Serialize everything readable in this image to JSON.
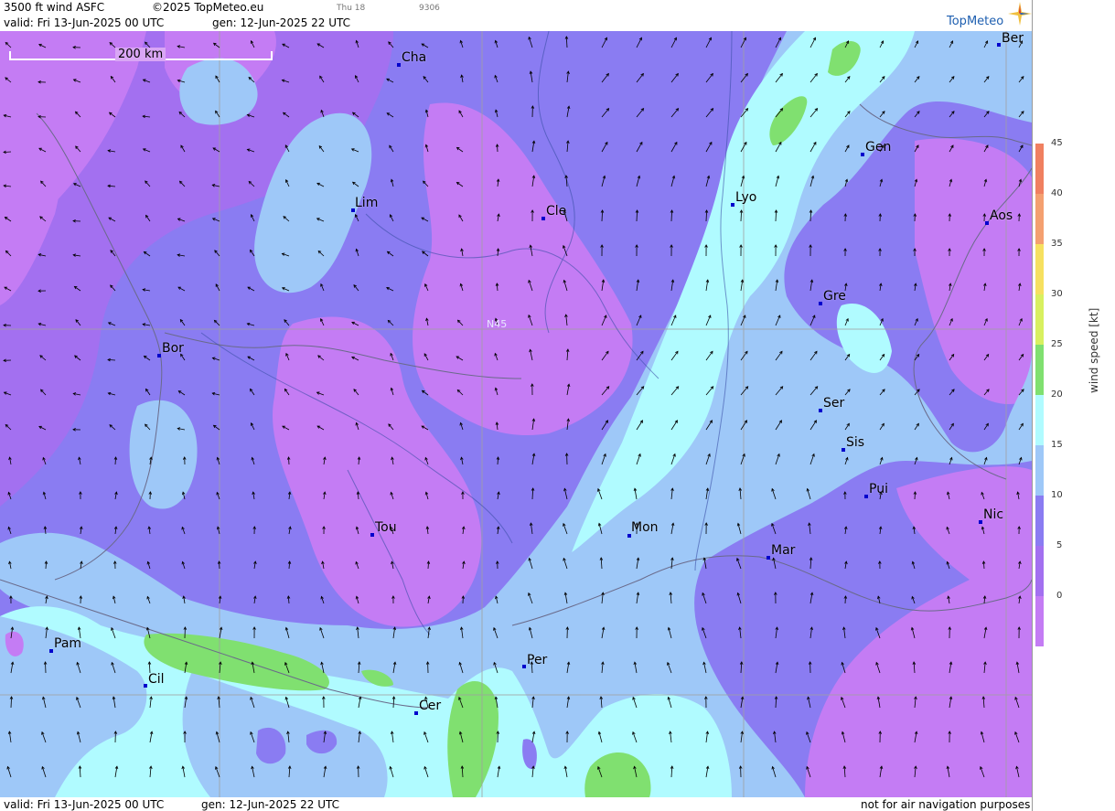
{
  "header": {
    "title": "3500 ft wind ASFC",
    "copyright": "©2025 TopMeteo.eu",
    "day_label": "Thu 18",
    "code": "9306",
    "valid": "valid:  Fri  13-Jun-2025  00 UTC",
    "gen": "gen: 12-Jun-2025 22 UTC",
    "logo": "TopMeteo"
  },
  "footer": {
    "valid": "valid:  Fri  13-Jun-2025  00 UTC",
    "gen": "gen: 12-Jun-2025 22 UTC",
    "disclaimer": "not for air navigation purposes"
  },
  "scale": {
    "label": "200 km"
  },
  "grid": {
    "lat_label": "N45"
  },
  "cities": [
    {
      "name": "Cha"
    },
    {
      "name": "Ber"
    },
    {
      "name": "Lim"
    },
    {
      "name": "Cle"
    },
    {
      "name": "Lyo"
    },
    {
      "name": "Gen"
    },
    {
      "name": "Aos"
    },
    {
      "name": "Gre"
    },
    {
      "name": "Bor"
    },
    {
      "name": "Ser"
    },
    {
      "name": "Sis"
    },
    {
      "name": "Pui"
    },
    {
      "name": "Nic"
    },
    {
      "name": "Tou"
    },
    {
      "name": "Mon"
    },
    {
      "name": "Mar"
    },
    {
      "name": "Pam"
    },
    {
      "name": "Per"
    },
    {
      "name": "Cil"
    },
    {
      "name": "Cer"
    }
  ],
  "legend": {
    "title": "wind speed [kt]",
    "ticks": [
      "45",
      "40",
      "35",
      "30",
      "25",
      "20",
      "15",
      "10",
      "5",
      "0"
    ],
    "colors": [
      "#f08060",
      "#f4a070",
      "#f6e060",
      "#d8f060",
      "#80e070",
      "#b0fbff",
      "#9ec8f8",
      "#8a7cf2",
      "#a370f0",
      "#c47cf4"
    ]
  },
  "colors": {
    "very_light": "#c47cf4",
    "light": "#a370f0",
    "moderate": "#8a7cf2",
    "fresh": "#9ec8f8",
    "strong": "#b0fbff",
    "stronger": "#80e070"
  }
}
